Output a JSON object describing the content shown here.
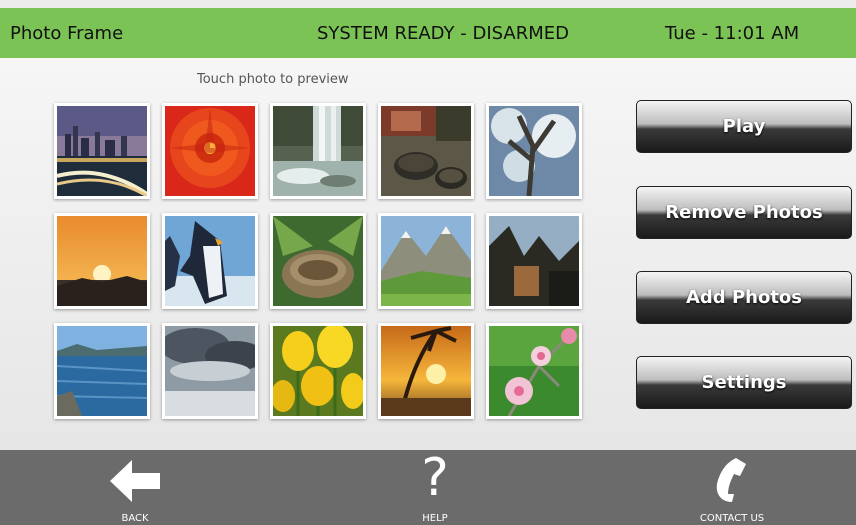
{
  "header": {
    "title": "Photo Frame",
    "status": "SYSTEM READY - DISARMED",
    "datetime": "Tue - 11:01 AM",
    "bg_color": "#7cc356"
  },
  "main": {
    "hint": "Touch photo to preview",
    "photos": [
      {
        "name": "photo-city-skyline"
      },
      {
        "name": "photo-red-flower"
      },
      {
        "name": "photo-waterfall"
      },
      {
        "name": "photo-tortoises"
      },
      {
        "name": "photo-blossom-tree"
      },
      {
        "name": "photo-sunset"
      },
      {
        "name": "photo-penguins"
      },
      {
        "name": "photo-bird-nest"
      },
      {
        "name": "photo-mountain-valley"
      },
      {
        "name": "photo-forest-rocks"
      },
      {
        "name": "photo-lake"
      },
      {
        "name": "photo-storm-clouds"
      },
      {
        "name": "photo-yellow-tulips"
      },
      {
        "name": "photo-tropical-sunset"
      },
      {
        "name": "photo-pink-blossoms"
      }
    ]
  },
  "actions": {
    "play": "Play",
    "remove": "Remove Photos",
    "add": "Add Photos",
    "settings": "Settings"
  },
  "footer": {
    "back": "BACK",
    "help": "HELP",
    "contact": "CONTACT US",
    "bg_color": "#6b6b6b",
    "icons": [
      "back-arrow-icon",
      "question-mark-icon",
      "phone-icon"
    ]
  }
}
